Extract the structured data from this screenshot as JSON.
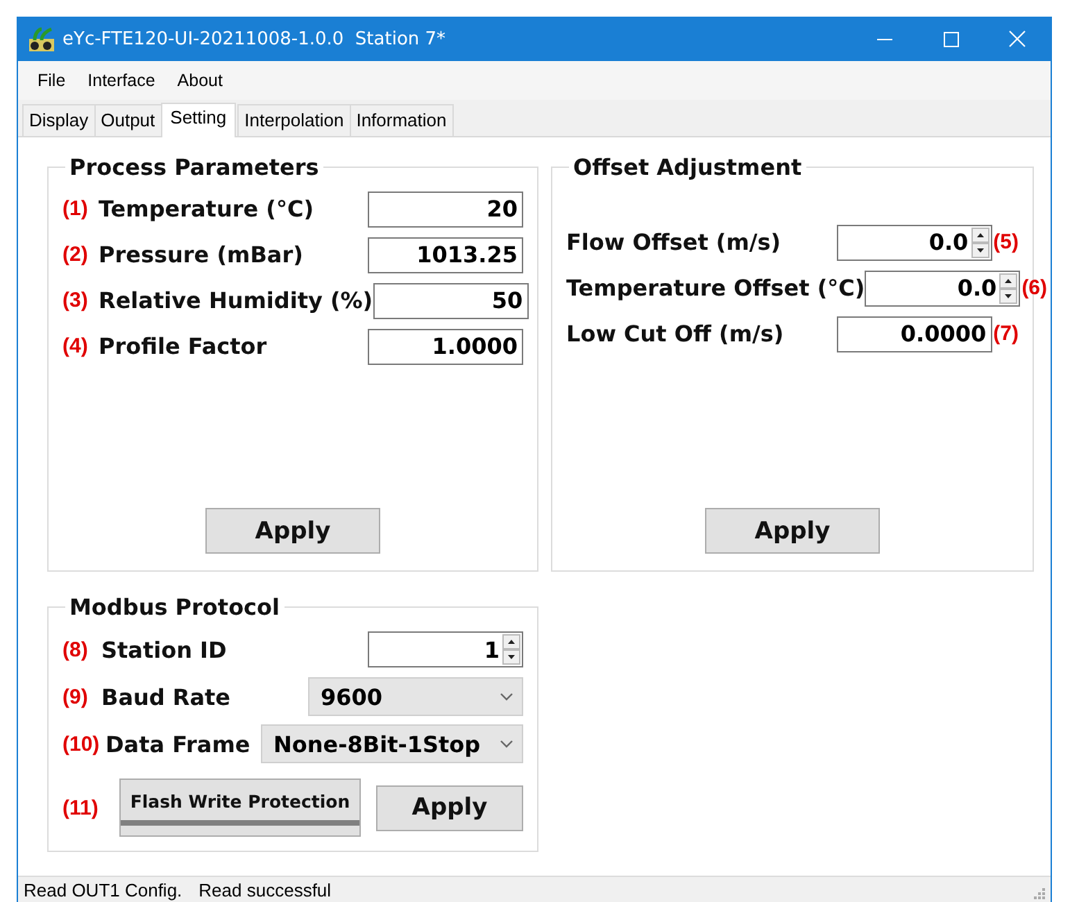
{
  "window": {
    "title": "eYc-FTE120-UI-20211008-1.0.0  Station 7*"
  },
  "menu": [
    "File",
    "Interface",
    "About"
  ],
  "tabs": [
    {
      "label": "Display",
      "selected": false
    },
    {
      "label": "Output",
      "selected": false
    },
    {
      "label": "Setting",
      "selected": true
    },
    {
      "label": "Interpolation",
      "selected": false
    },
    {
      "label": "Information",
      "selected": false
    }
  ],
  "process_parameters": {
    "title": "Process Parameters",
    "fields": [
      {
        "marker": "(1)",
        "label": "Temperature (°C)",
        "value": "20"
      },
      {
        "marker": "(2)",
        "label": "Pressure (mBar)",
        "value": "1013.25"
      },
      {
        "marker": "(3)",
        "label": "Relative Humidity (%)",
        "value": "50"
      },
      {
        "marker": "(4)",
        "label": "Profile Factor",
        "value": "1.0000"
      }
    ],
    "apply": "Apply"
  },
  "offset_adjustment": {
    "title": "Offset Adjustment",
    "fields": [
      {
        "marker": "(5)",
        "label": "Flow Offset (m/s)",
        "value": "0.0",
        "kind": "spin"
      },
      {
        "marker": "(6)",
        "label": "Temperature Offset (°C)",
        "value": "0.0",
        "kind": "spin"
      },
      {
        "marker": "(7)",
        "label": "Low Cut Off (m/s)",
        "value": "0.0000",
        "kind": "text"
      }
    ],
    "apply": "Apply"
  },
  "modbus_protocol": {
    "title": "Modbus Protocol",
    "fields": [
      {
        "marker": "(8)",
        "label": "Station ID",
        "value": "1",
        "kind": "spin"
      },
      {
        "marker": "(9)",
        "label": "Baud Rate",
        "value": "9600",
        "kind": "combo"
      },
      {
        "marker": "(10)",
        "label": "Data Frame",
        "value": "None-8Bit-1Stop",
        "kind": "combo"
      }
    ],
    "flash_button": {
      "marker": "(11)",
      "label": "Flash Write Protection"
    },
    "apply": "Apply"
  },
  "status_bar": [
    "Read OUT1 Config.",
    "Read successful"
  ]
}
